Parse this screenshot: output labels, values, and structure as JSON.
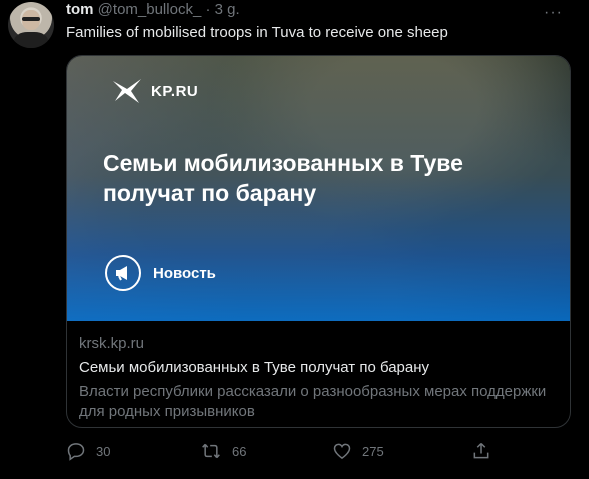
{
  "tweet": {
    "name": "tom",
    "handle": "@tom_bullock_",
    "separator": "·",
    "time": "3 g.",
    "more_label": "···",
    "text": "Families of mobilised troops in Tuva to receive one sheep"
  },
  "card": {
    "logo_text": "KP.RU",
    "headline": "Семьи мобилизованных в Туве получат по барану",
    "badge_text": "Новость",
    "domain": "krsk.kp.ru",
    "title": "Семьи мобилизованных в Туве получат по барану",
    "description": "Власти республики рассказали о разнообразных мерах поддержки для родных призывников"
  },
  "actions": {
    "reply_count": "30",
    "retweet_count": "66",
    "like_count": "275"
  },
  "colors": {
    "background": "#000000",
    "text_primary": "#e7e9ea",
    "text_secondary": "#71767b",
    "border": "#2f3336",
    "card_overlay_blue": "#006ed2"
  },
  "icons": [
    "avatar",
    "more-icon",
    "kp-logo-icon",
    "megaphone-icon",
    "reply-icon",
    "retweet-icon",
    "like-icon",
    "share-icon"
  ]
}
